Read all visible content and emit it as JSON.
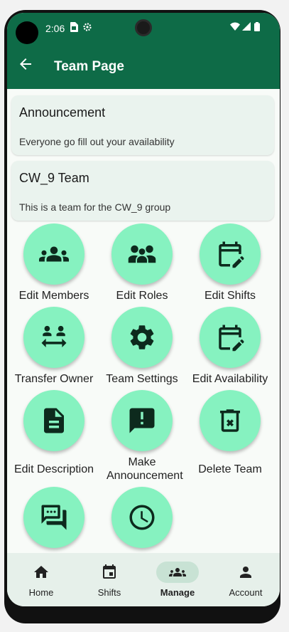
{
  "status_bar": {
    "time": "2:06"
  },
  "app_bar": {
    "title": "Team Page"
  },
  "announcement_card": {
    "title": "Announcement",
    "body": "Everyone go fill out your availability"
  },
  "team_card": {
    "title": "CW_9 Team",
    "body": "This is a team for the CW_9 group"
  },
  "actions": [
    {
      "label": "Edit Members",
      "icon": "group-icon"
    },
    {
      "label": "Edit Roles",
      "icon": "roles-icon"
    },
    {
      "label": "Edit Shifts",
      "icon": "edit-calendar-icon"
    },
    {
      "label": "Transfer Owner",
      "icon": "transfer-icon"
    },
    {
      "label": "Team Settings",
      "icon": "gear-icon"
    },
    {
      "label": "Edit Availability",
      "icon": "edit-calendar-icon"
    },
    {
      "label": "Edit Description",
      "icon": "document-icon"
    },
    {
      "label": "Make Announcement",
      "icon": "announcement-icon"
    },
    {
      "label": "Delete Team",
      "icon": "delete-icon"
    },
    {
      "label": "",
      "icon": "chat-icon"
    },
    {
      "label": "",
      "icon": "clock-icon"
    }
  ],
  "bottom_nav": {
    "items": [
      {
        "label": "Home",
        "icon": "home-icon",
        "active": false
      },
      {
        "label": "Shifts",
        "icon": "calendar-icon",
        "active": false
      },
      {
        "label": "Manage",
        "icon": "group-icon",
        "active": true
      },
      {
        "label": "Account",
        "icon": "person-icon",
        "active": false
      }
    ]
  },
  "colors": {
    "primary": "#0e6b47",
    "button": "#86f2c0",
    "card": "#eaf3ee",
    "nav_bg": "#e6f0ea"
  }
}
